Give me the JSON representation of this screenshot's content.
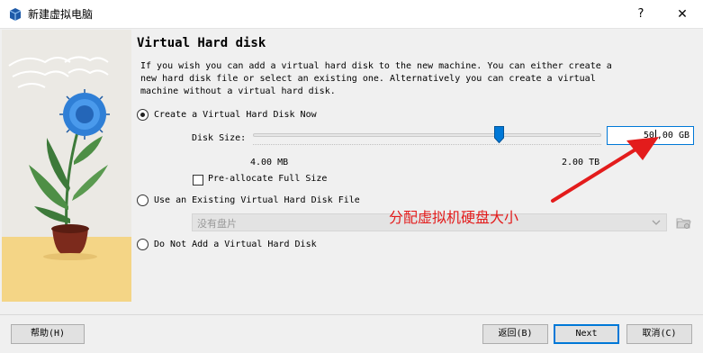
{
  "window": {
    "title": "新建虚拟电脑",
    "help_label": "?",
    "close_label": "✕",
    "icon": "virtualbox-icon"
  },
  "page": {
    "heading": "Virtual Hard disk",
    "description": "If you wish you can add a virtual hard disk to the new machine. You can either create a new hard disk file or select an existing one. Alternatively you can create a virtual machine without a virtual hard disk."
  },
  "options": {
    "create": {
      "label": "Create a Virtual Hard Disk Now",
      "selected": true
    },
    "existing": {
      "label": "Use an Existing Virtual Hard Disk File",
      "selected": false
    },
    "none": {
      "label": "Do Not Add a Virtual Hard Disk",
      "selected": false
    }
  },
  "disk_size": {
    "label": "Disk Size:",
    "value_before_caret": "50",
    "value_after_caret": ",00 GB",
    "min_label": "4.00 MB",
    "max_label": "2.00 TB",
    "slider_fraction": 0.7
  },
  "preallocate": {
    "label": "Pre-allocate Full Size",
    "checked": false
  },
  "existing_disk": {
    "selected_value": "没有盘片"
  },
  "annotation": {
    "text": "分配虚拟机硬盘大小",
    "color": "#e31c1c"
  },
  "buttons": {
    "help": "帮助(H)",
    "back": "返回(B)",
    "next": "Next",
    "cancel": "取消(C)"
  },
  "colors": {
    "accent": "#0078d7",
    "annotation": "#e31c1c",
    "flower": "#2f7fd6"
  }
}
